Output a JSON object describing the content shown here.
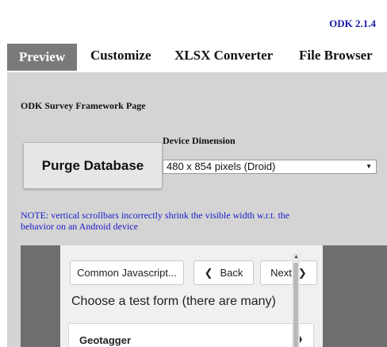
{
  "app": {
    "version": "ODK 2.1.4"
  },
  "tabs": [
    "Preview",
    "Customize",
    "XLSX Converter",
    "File Browser"
  ],
  "page_label": "ODK Survey Framework Page",
  "purge_button": "Purge Database",
  "device_dimension": {
    "label": "Device Dimension",
    "selected": "480 x 854 pixels (Droid)"
  },
  "note": "NOTE: vertical scrollbars incorrectly shrink the visible width w.r.t. the behavior on an Android device",
  "device_preview": {
    "common_js_button": "Common Javascript...",
    "back_button": "Back",
    "next_button": "Next",
    "prompt": "Choose a test form (there are many)",
    "form_items": [
      "Geotagger"
    ]
  }
}
